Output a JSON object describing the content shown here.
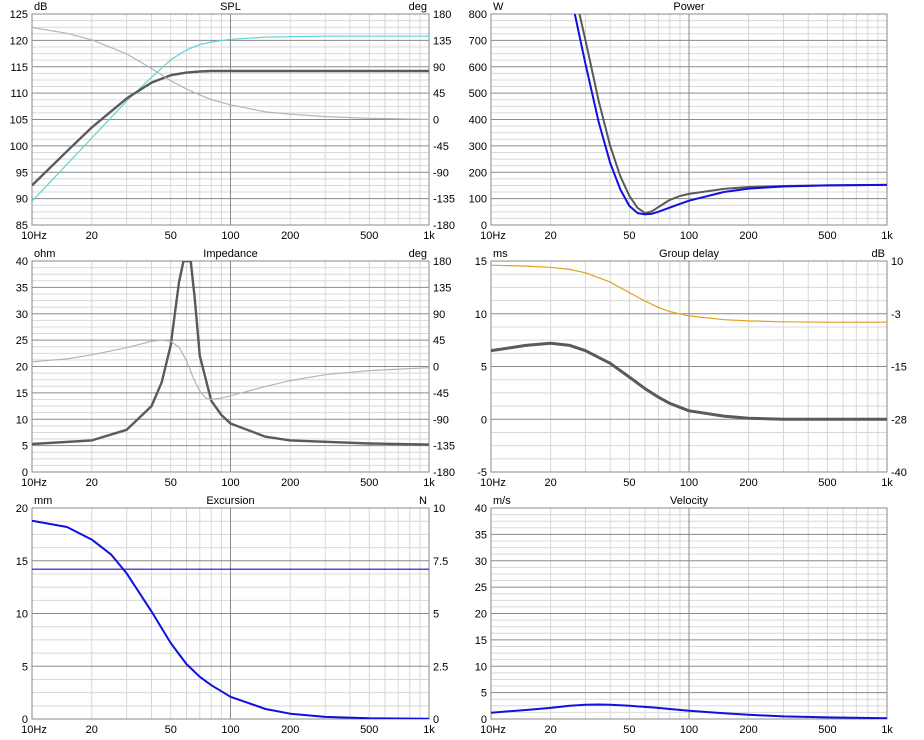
{
  "chart_data": [
    {
      "type": "line",
      "title": "SPL",
      "ylabel": "dB",
      "y2label": "deg",
      "xlim": [
        10,
        1000
      ],
      "ylim": [
        85,
        125
      ],
      "y2lim": [
        -180,
        180
      ],
      "xscale": "log",
      "x_tick_labels": [
        "10Hz",
        "20",
        "50",
        "100",
        "200",
        "500",
        "1k"
      ],
      "y_tick_labels": [
        "125",
        "120",
        "115",
        "110",
        "105",
        "100",
        "95",
        "90",
        "85"
      ],
      "y2_tick_labels": [
        "180",
        "135",
        "90",
        "45",
        "0",
        "-45",
        "-90",
        "-135",
        "-180"
      ],
      "series": [
        {
          "axis": "y",
          "color": "#5fd3d3",
          "width": 1.2,
          "x": [
            10,
            15,
            20,
            30,
            40,
            50,
            60,
            70,
            80,
            100,
            150,
            200,
            300,
            500,
            1000
          ],
          "y": [
            89.5,
            96.5,
            101.5,
            108.5,
            113,
            116.3,
            118.2,
            119.2,
            119.7,
            120.2,
            120.6,
            120.7,
            120.8,
            120.8,
            120.8
          ]
        },
        {
          "axis": "y",
          "color": "#5a5a5a",
          "width": 2.4,
          "x": [
            10,
            15,
            20,
            30,
            40,
            50,
            60,
            70,
            80,
            100,
            150,
            200,
            300,
            500,
            1000
          ],
          "y": [
            92.5,
            99,
            103.5,
            109,
            112,
            113.4,
            113.9,
            114.1,
            114.2,
            114.2,
            114.2,
            114.2,
            114.2,
            114.2,
            114.2
          ]
        },
        {
          "axis": "y2",
          "color": "#b4b4b4",
          "width": 1.2,
          "x": [
            10,
            15,
            20,
            30,
            40,
            50,
            60,
            70,
            80,
            100,
            150,
            200,
            300,
            500,
            1000
          ],
          "y": [
            157,
            147,
            136,
            112,
            87,
            66,
            52,
            42,
            34,
            25,
            13,
            9,
            5,
            2,
            0
          ]
        }
      ]
    },
    {
      "type": "line",
      "title": "Power",
      "ylabel": "W",
      "xlim": [
        10,
        1000
      ],
      "ylim": [
        0,
        800
      ],
      "xscale": "log",
      "x_tick_labels": [
        "10Hz",
        "20",
        "50",
        "100",
        "200",
        "500",
        "1k"
      ],
      "y_tick_labels": [
        "800",
        "700",
        "600",
        "500",
        "400",
        "300",
        "200",
        "100",
        "0"
      ],
      "series": [
        {
          "axis": "y",
          "color": "#5a5a5a",
          "width": 2,
          "x": [
            28,
            30,
            35,
            40,
            45,
            50,
            55,
            60,
            65,
            70,
            80,
            90,
            100,
            150,
            200,
            300,
            500,
            1000
          ],
          "y": [
            800,
            700,
            470,
            300,
            185,
            110,
            65,
            45,
            52,
            68,
            95,
            110,
            118,
            137,
            144,
            148,
            150,
            152
          ]
        },
        {
          "axis": "y",
          "color": "#1010e0",
          "width": 2,
          "x": [
            26.5,
            30,
            35,
            40,
            45,
            50,
            55,
            60,
            65,
            70,
            80,
            100,
            150,
            200,
            300,
            500,
            1000
          ],
          "y": [
            800,
            610,
            390,
            235,
            135,
            72,
            45,
            40,
            43,
            50,
            66,
            92,
            125,
            138,
            146,
            150,
            152
          ]
        }
      ]
    },
    {
      "type": "line",
      "title": "Impedance",
      "ylabel": "ohm",
      "y2label": "deg",
      "xlim": [
        10,
        1000
      ],
      "ylim": [
        0,
        40
      ],
      "y2lim": [
        -180,
        180
      ],
      "xscale": "log",
      "x_tick_labels": [
        "10Hz",
        "20",
        "50",
        "100",
        "200",
        "500",
        "1k"
      ],
      "y_tick_labels": [
        "40",
        "35",
        "30",
        "25",
        "20",
        "15",
        "10",
        "5",
        "0"
      ],
      "y2_tick_labels": [
        "180",
        "135",
        "90",
        "45",
        "0",
        "-45",
        "-90",
        "-135",
        "-180"
      ],
      "series": [
        {
          "axis": "y",
          "color": "#5a5a5a",
          "width": 2.4,
          "x": [
            10,
            20,
            30,
            40,
            45,
            50,
            55,
            58,
            60,
            63,
            66,
            70,
            80,
            90,
            100,
            150,
            200,
            500,
            1000
          ],
          "y": [
            5.3,
            6,
            8,
            12.5,
            17,
            24,
            36,
            40,
            40,
            40,
            33,
            22,
            13.5,
            10.8,
            9.2,
            6.7,
            6,
            5.4,
            5.2
          ]
        },
        {
          "axis": "y2",
          "color": "#b4b4b4",
          "width": 1.2,
          "x": [
            10,
            15,
            20,
            30,
            40,
            45,
            50,
            55,
            60,
            65,
            70,
            75,
            80,
            90,
            100,
            150,
            200,
            300,
            500,
            1000
          ],
          "y": [
            8,
            13,
            20,
            32,
            43,
            45,
            43,
            33,
            10,
            -20,
            -42,
            -54,
            -56,
            -54,
            -50,
            -34,
            -24,
            -14,
            -7,
            -2
          ]
        }
      ]
    },
    {
      "type": "line",
      "title": "Group delay",
      "ylabel": "ms",
      "y2label": "dB",
      "xlim": [
        10,
        1000
      ],
      "ylim": [
        -5,
        15
      ],
      "y2lim": [
        -40,
        10
      ],
      "xscale": "log",
      "x_tick_labels": [
        "10Hz",
        "20",
        "50",
        "100",
        "200",
        "500",
        "1k"
      ],
      "y_tick_labels": [
        "15",
        "10",
        "5",
        "0",
        "-5"
      ],
      "y2_tick_labels": [
        "10",
        "-3",
        "-15",
        "-28",
        "-40"
      ],
      "series": [
        {
          "axis": "y",
          "color": "#5a5a5a",
          "width": 3,
          "x": [
            10,
            15,
            20,
            25,
            30,
            40,
            50,
            60,
            70,
            80,
            100,
            150,
            200,
            300,
            500,
            1000
          ],
          "y": [
            6.5,
            7,
            7.2,
            7,
            6.5,
            5.3,
            4,
            2.9,
            2.1,
            1.5,
            0.8,
            0.3,
            0.1,
            0,
            0,
            0
          ]
        },
        {
          "axis": "y2",
          "color": "#e0a020",
          "width": 1.2,
          "x": [
            10,
            15,
            20,
            25,
            30,
            40,
            50,
            60,
            70,
            80,
            100,
            150,
            200,
            300,
            500,
            1000
          ],
          "y": [
            9,
            8.8,
            8.5,
            8,
            7.2,
            5,
            2.5,
            0.5,
            -1,
            -2,
            -3,
            -3.9,
            -4.2,
            -4.4,
            -4.5,
            -4.5
          ]
        }
      ]
    },
    {
      "type": "line",
      "title": "Excursion",
      "ylabel": "mm",
      "y2label": "N",
      "xlim": [
        10,
        1000
      ],
      "ylim": [
        0,
        20
      ],
      "y2lim": [
        0,
        10
      ],
      "xscale": "log",
      "x_tick_labels": [
        "10Hz",
        "20",
        "50",
        "100",
        "200",
        "500",
        "1k"
      ],
      "y_tick_labels": [
        "20",
        "15",
        "10",
        "5",
        "0"
      ],
      "y2_tick_labels": [
        "10",
        "7.5",
        "5",
        "2.5",
        "0"
      ],
      "series": [
        {
          "axis": "y",
          "color": "#1010e0",
          "width": 2,
          "x": [
            10,
            15,
            20,
            25,
            30,
            40,
            50,
            60,
            70,
            80,
            100,
            150,
            200,
            300,
            500,
            1000
          ],
          "y": [
            18.8,
            18.2,
            17,
            15.6,
            13.8,
            10.2,
            7.2,
            5.2,
            4,
            3.2,
            2.1,
            0.95,
            0.5,
            0.2,
            0.07,
            0.02
          ]
        },
        {
          "axis": "y",
          "color": "#1010e0",
          "width": 1.2,
          "x": [
            10,
            1000
          ],
          "y": [
            14.2,
            14.2
          ]
        }
      ]
    },
    {
      "type": "line",
      "title": "Velocity",
      "ylabel": "m/s",
      "xlim": [
        10,
        1000
      ],
      "ylim": [
        0,
        40
      ],
      "xscale": "log",
      "x_tick_labels": [
        "10Hz",
        "20",
        "50",
        "100",
        "200",
        "500",
        "1k"
      ],
      "y_tick_labels": [
        "40",
        "35",
        "30",
        "25",
        "20",
        "15",
        "10",
        "5",
        "0"
      ],
      "series": [
        {
          "axis": "y",
          "color": "#1010e0",
          "width": 2,
          "x": [
            10,
            15,
            20,
            25,
            30,
            35,
            40,
            50,
            60,
            70,
            80,
            100,
            150,
            200,
            300,
            500,
            1000
          ],
          "y": [
            1.2,
            1.7,
            2.1,
            2.5,
            2.7,
            2.75,
            2.7,
            2.5,
            2.3,
            2.1,
            1.9,
            1.55,
            1.1,
            0.8,
            0.5,
            0.3,
            0.15
          ]
        }
      ]
    }
  ]
}
